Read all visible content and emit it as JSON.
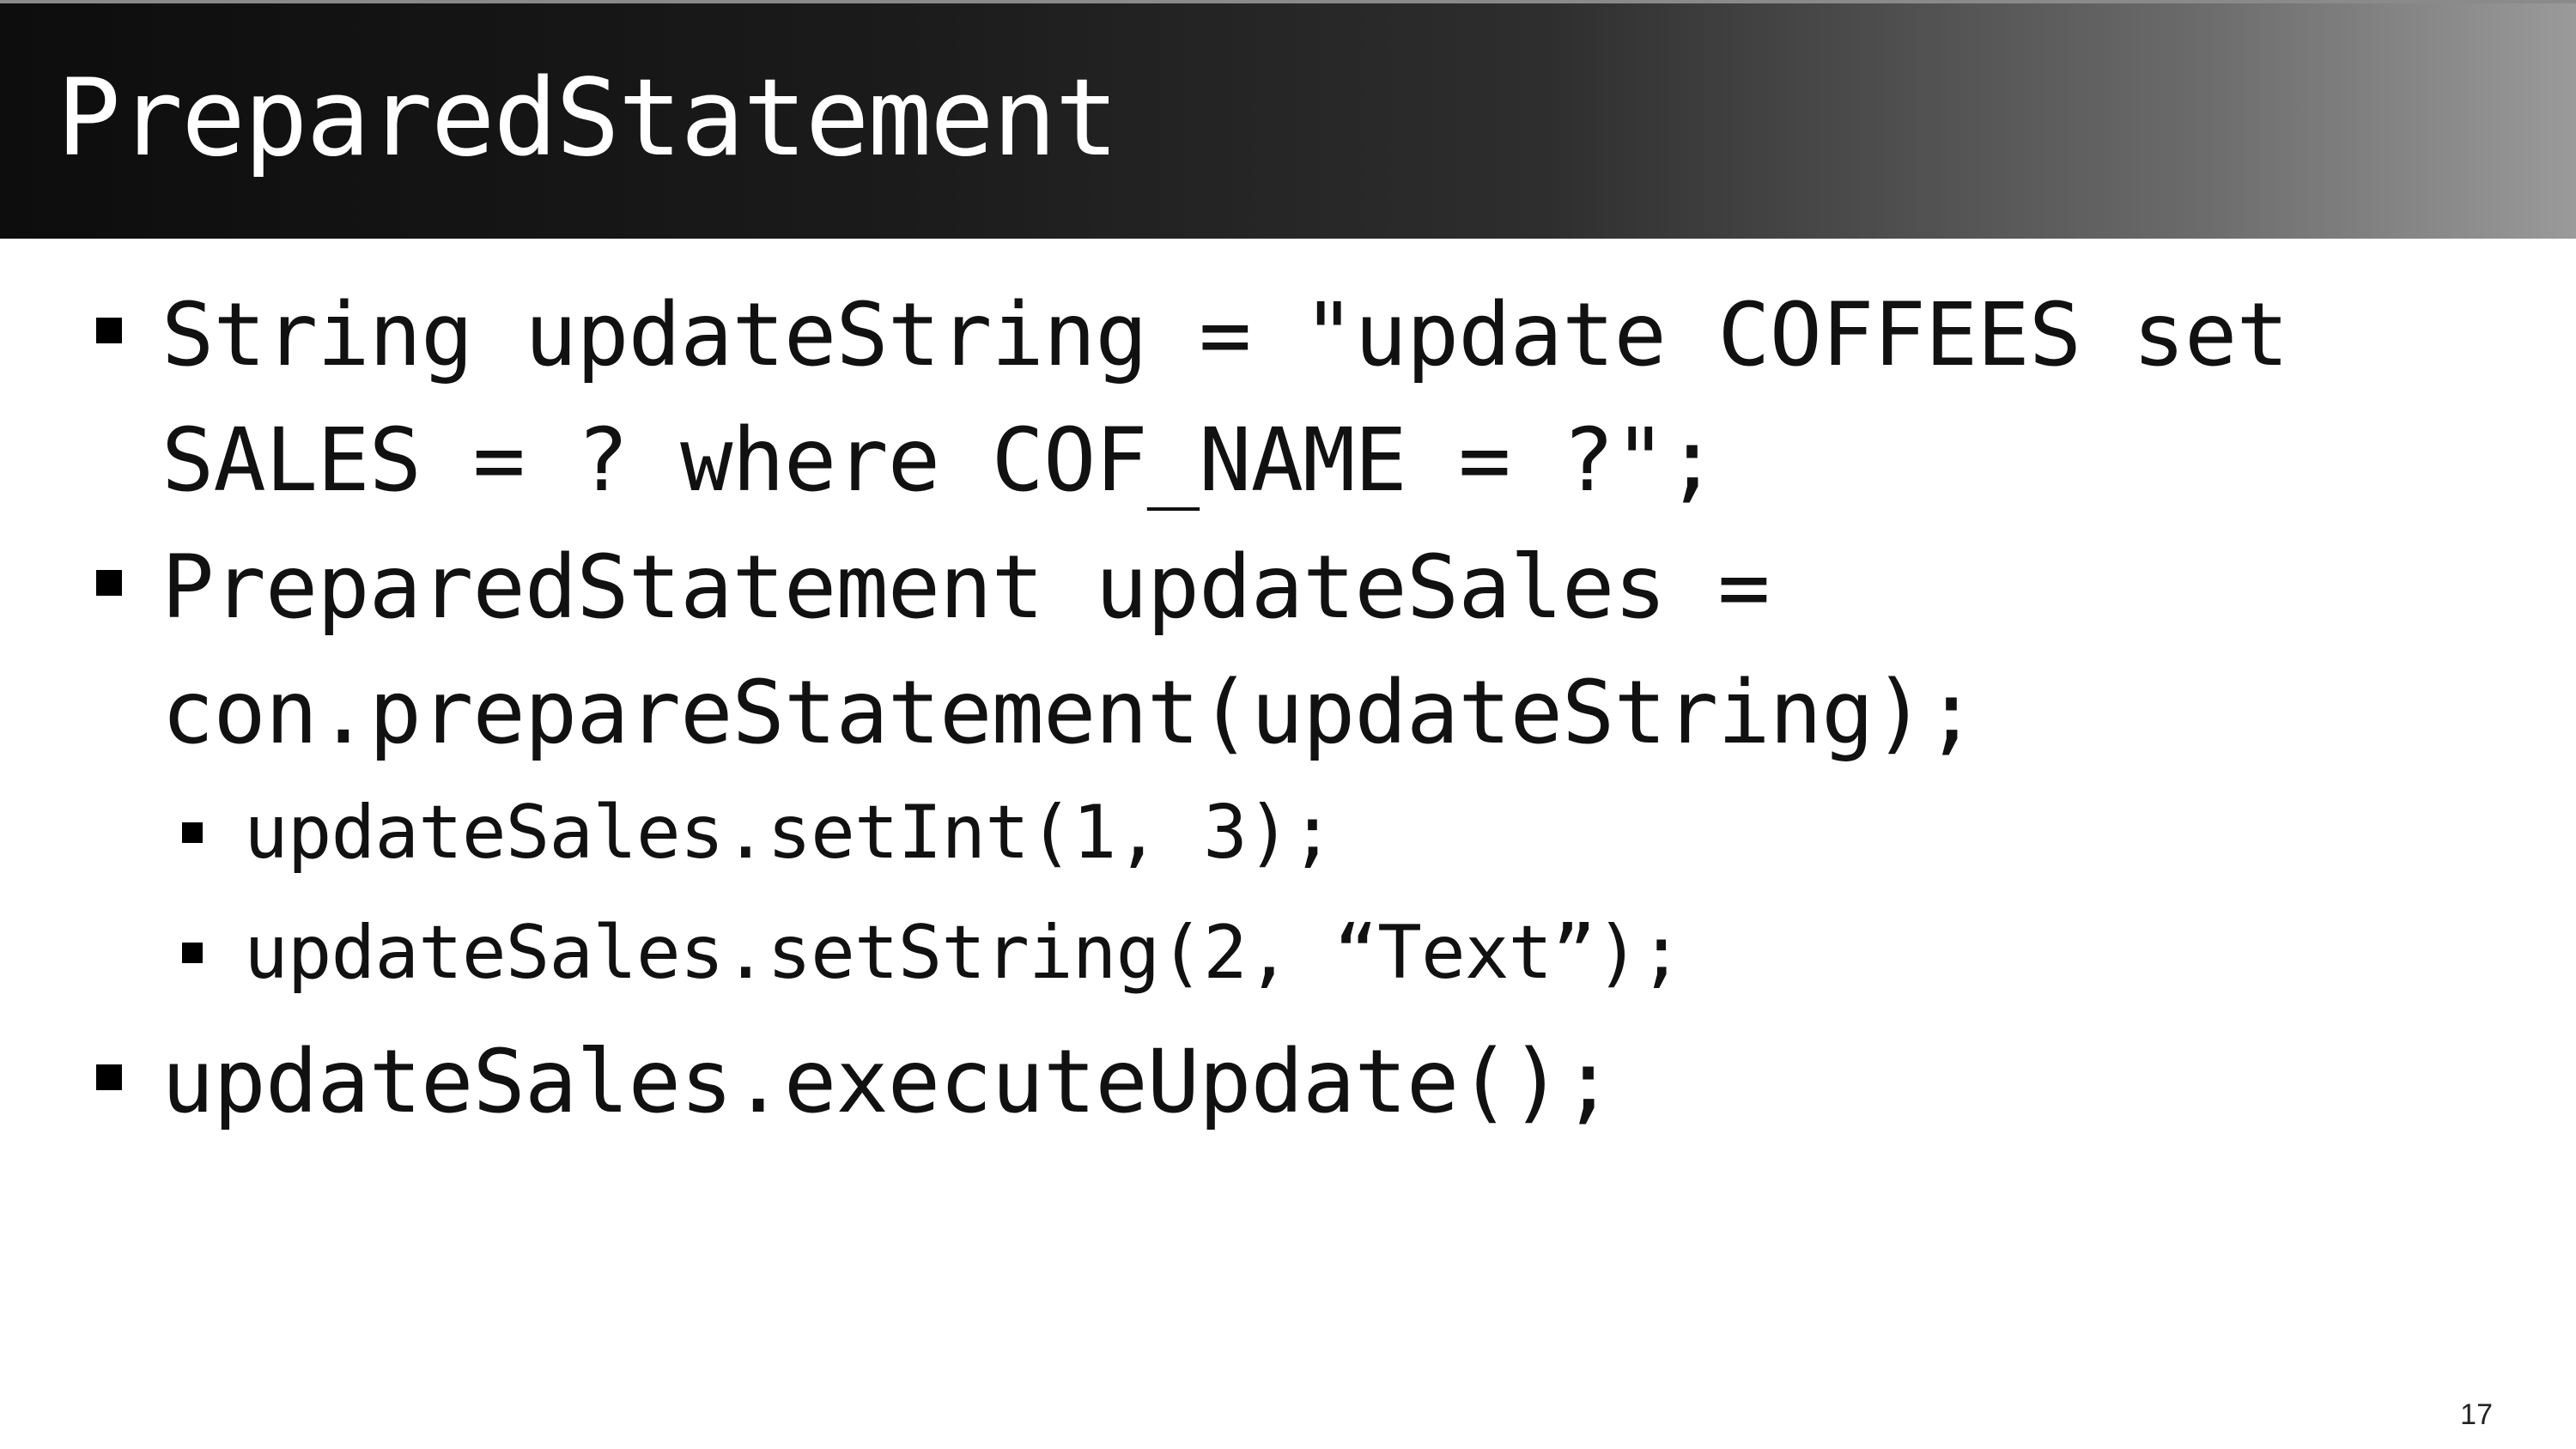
{
  "slide": {
    "title": "PreparedStatement",
    "bullets": [
      {
        "lines": [
          "String updateString = \"update COFFEES set",
          "SALES = ? where COF_NAME = ?\";"
        ]
      },
      {
        "lines": [
          "PreparedStatement updateSales =",
          "con.prepareStatement(updateString);"
        ]
      },
      {
        "sub": [
          "updateSales.setInt(1, 3);",
          "updateSales.setString(2, “Text”);"
        ]
      },
      {
        "lines": [
          "updateSales.executeUpdate();"
        ]
      }
    ],
    "page_number": "17"
  },
  "colors": {
    "title_bar_dark": "#0d0d0d",
    "title_bar_light": "#9a9a9a",
    "title_text": "#ffffff",
    "body_text": "#111111"
  },
  "icons": {
    "bullet": "square-bullet-icon"
  }
}
